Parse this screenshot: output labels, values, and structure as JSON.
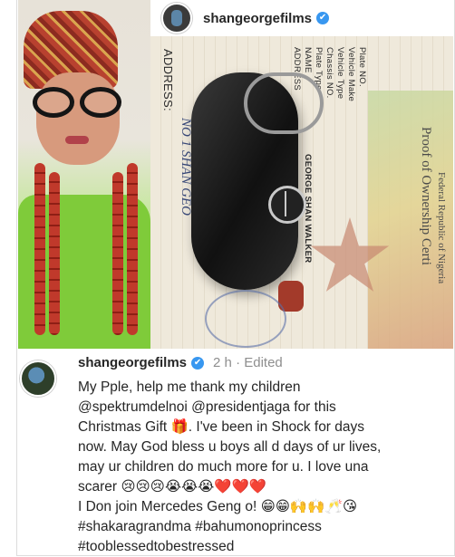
{
  "post": {
    "username": "shangeorgefilms",
    "verified_mark": "✔"
  },
  "document": {
    "labels": [
      "Plate NO.",
      "Vehicle Make",
      "Vehicle Type",
      "Chassis NO.",
      "Plate Type",
      "NAME",
      "ADDRESS"
    ],
    "name_value": "GEORGE SHAN WALKER",
    "title": "Proof of Ownership Certi",
    "header": "Federal Republic of Nigeria",
    "address_label": "ADDRESS:",
    "address_hand": "NO 1 SHAN GEO"
  },
  "comment": {
    "username": "shangeorgefilms",
    "verified_mark": "✔",
    "time": "2 h",
    "separator": "·",
    "edited": "Edited",
    "lines": [
      "My Pple, help me thank my children",
      "@spektrumdelnoi @presidentjaga for this",
      "Christmas Gift 🎁. I've been in Shock for days",
      "now. May God bless u boys all d days of ur lives,",
      "may ur children do much more for u. I love una",
      "scarer 😢😢😢😭😭😭❤️❤️❤️",
      "I Don join Mercedes Geng o! 😁😁🙌🙌🥂😘",
      "#shakaragrandma #bahumonoprincess",
      "#tooblessedtobestressed"
    ]
  }
}
